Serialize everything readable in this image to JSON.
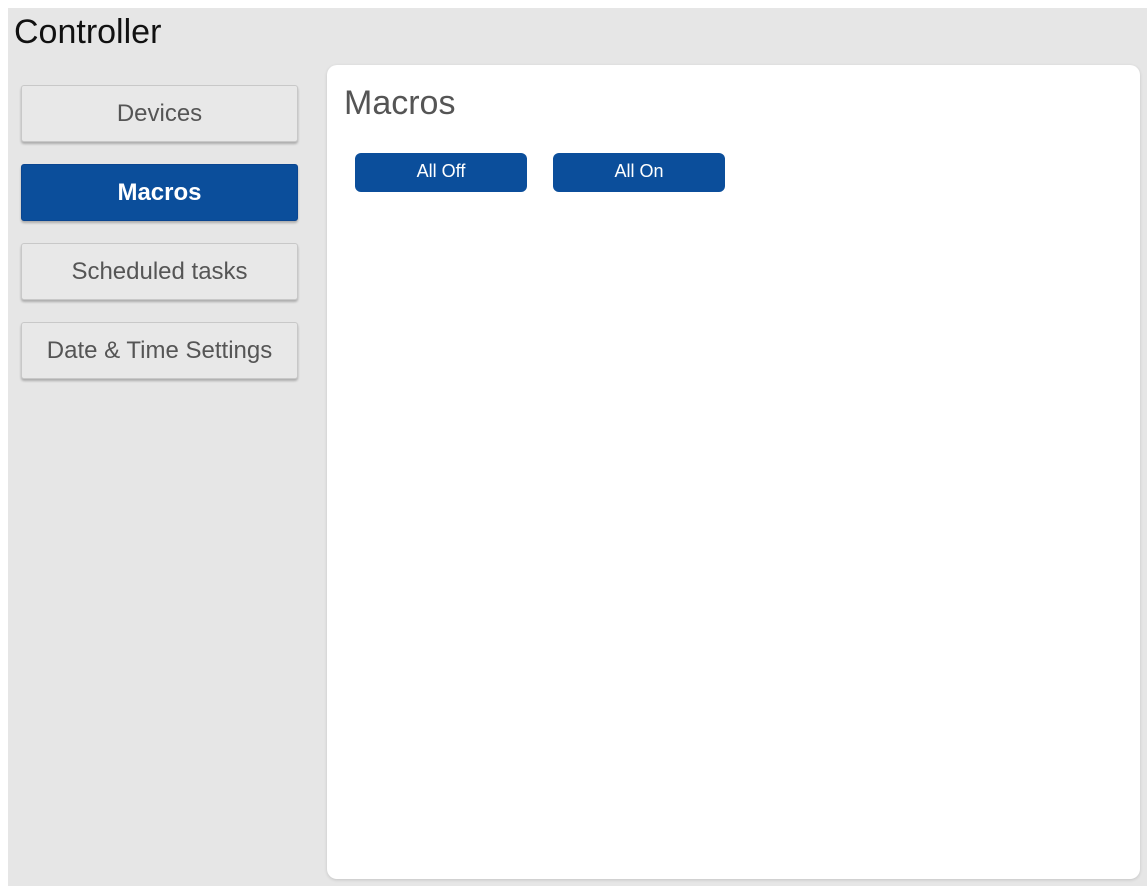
{
  "app": {
    "title": "Controller"
  },
  "sidebar": {
    "items": [
      {
        "label": "Devices",
        "active": false
      },
      {
        "label": "Macros",
        "active": true
      },
      {
        "label": "Scheduled tasks",
        "active": false
      },
      {
        "label": "Date & Time Settings",
        "active": false
      }
    ]
  },
  "main": {
    "title": "Macros",
    "macros": [
      {
        "label": "All Off"
      },
      {
        "label": "All On"
      }
    ]
  },
  "colors": {
    "accent": "#0b4e9b",
    "background": "#e6e6e6",
    "panel": "#ffffff",
    "button_idle": "#e8e8e8"
  }
}
